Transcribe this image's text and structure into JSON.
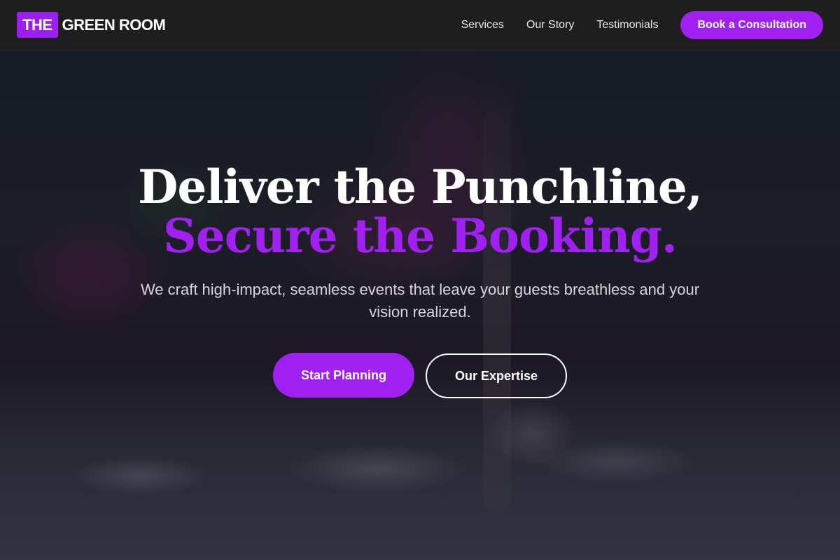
{
  "header": {
    "logo": {
      "badge": "THE",
      "text": "GREEN ROOM"
    },
    "nav": [
      {
        "label": "Services"
      },
      {
        "label": "Our Story"
      },
      {
        "label": "Testimonials"
      }
    ],
    "cta_label": "Book a Consultation"
  },
  "hero": {
    "title_line1": "Deliver the Punchline,",
    "title_line2": "Secure the Booking.",
    "subtitle": "We craft high-impact, seamless events that leave your guests breathless and your vision realized.",
    "primary_button": "Start Planning",
    "secondary_button": "Our Expertise"
  },
  "colors": {
    "accent": "#a020f0",
    "header_bg": "#1e1e1e",
    "text_light": "#ffffff"
  }
}
